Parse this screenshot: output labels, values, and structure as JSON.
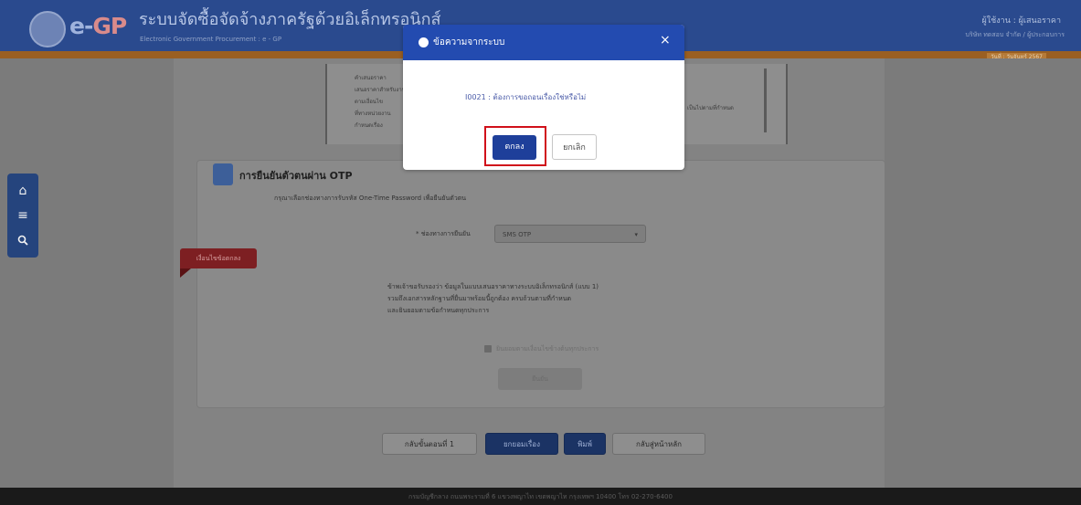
{
  "header": {
    "logo_main": "e-",
    "logo_accent": "GP",
    "app_title": "ระบบจัดซื้อจัดจ้างภาครัฐด้วยอิเล็กทรอนิกส์",
    "app_subtitle": "Electronic Government Procurement : e - GP",
    "user_name": "ผู้ใช้งาน : ผู้เสนอราคา",
    "user_org": "บริษัท ทดสอบ จำกัด / ผู้ประกอบการ",
    "badge": "วันที่ : วันจันทร์ 2567"
  },
  "sidebar": {
    "home_icon": "⌂",
    "menu_icon": "≡",
    "search_icon": "🔍"
  },
  "document_panel": {
    "lines": [
      "คำเสนอราคา",
      "เสนอราคาสำหรับงาน",
      "ตามเงื่อนไข",
      "ที่ทางหน่วยงาน",
      "กำหนดเรื่อง"
    ],
    "note": "เป็นไปตามที่กำหนด"
  },
  "otp": {
    "title": "การยืนยันตัวตนผ่าน OTP",
    "description": "กรุณาเลือกช่องทางการรับรหัส One-Time Password เพื่อยืนยันตัวตน",
    "select_label": "* ช่องทางการยืนยัน",
    "select_value": "SMS OTP",
    "condition_tag": "เงื่อนไขข้อตกลง",
    "condition_lines": [
      "ข้าพเจ้าขอรับรองว่า ข้อมูลในแบบเสนอราคาทางระบบอิเล็กทรอนิกส์ (แบบ 1)",
      "รวมถึงเอกสารหลักฐานที่ยื่นมาพร้อมนี้ถูกต้อง ครบถ้วนตามที่กำหนด",
      "และยินยอมตามข้อกำหนดทุกประการ"
    ],
    "accept_label": "ยินยอมตามเงื่อนไขข้างต้นทุกประการ",
    "confirm_label": "ยืนยัน"
  },
  "actions": {
    "back_step": "กลับขั้นตอนที่ 1",
    "submit": "ยกยอมเรื่อง",
    "print": "พิมพ์",
    "home": "กลับสู่หน้าหลัก"
  },
  "footer": {
    "text": "กรมบัญชีกลาง ถนนพระรามที่ 6 แขวงพญาไท เขตพญาไท กรุงเทพฯ 10400 โทร 02-270-6400"
  },
  "dialog": {
    "title": "ข้อความจากระบบ",
    "close_icon": "×",
    "message": "I0021 : ต้องการขอถอนเรื่องใช่หรือไม่",
    "ok_label": "ตกลง",
    "cancel_label": "ยกเลิก"
  },
  "colors": {
    "header": "#2a4a8e",
    "dialog_header": "#234bb0",
    "primary_button": "#1e3f9a",
    "highlight": "#d0101a",
    "condition_tag": "#7d1f22"
  }
}
